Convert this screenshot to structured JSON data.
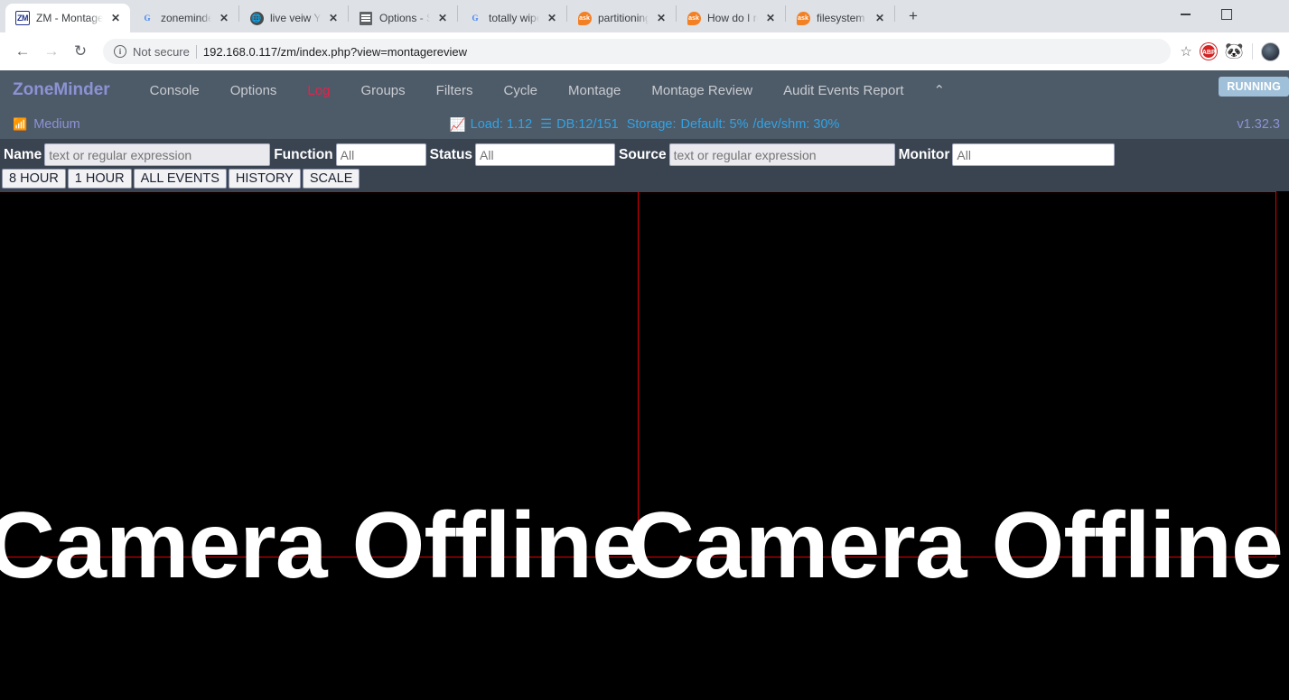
{
  "browser": {
    "tabs": [
      {
        "title": "ZM - Montage R",
        "favicon": "zm-icon",
        "active": true,
        "close_label": "✕"
      },
      {
        "title": "zoneminder opti",
        "favicon": "google-icon",
        "active": false,
        "close_label": "✕"
      },
      {
        "title": "live veiw YES on",
        "favicon": "globe-icon",
        "active": false,
        "close_label": "✕"
      },
      {
        "title": "Options - Server",
        "favicon": "options-icon",
        "active": false,
        "close_label": "✕"
      },
      {
        "title": "totally wipe ubun",
        "favicon": "google-icon",
        "active": false,
        "close_label": "✕"
      },
      {
        "title": "partitioning - Ho",
        "favicon": "askubuntu-icon",
        "active": false,
        "close_label": "✕"
      },
      {
        "title": "How do I reset U",
        "favicon": "askubuntu-icon",
        "active": false,
        "close_label": "✕"
      },
      {
        "title": "filesystem - How",
        "favicon": "askubuntu-icon",
        "active": false,
        "close_label": "✕"
      }
    ],
    "new_tab_label": "+",
    "window_controls": {
      "minimize": "—",
      "maximize": "□",
      "close": "✕"
    },
    "nav": {
      "back": "←",
      "forward": "→",
      "reload": "↻"
    },
    "omnibox": {
      "security_label": "Not secure",
      "info_icon": "info-icon",
      "url": "192.168.0.117/zm/index.php?view=montagereview",
      "star": "☆"
    },
    "extensions": [
      {
        "name": "adblock-plus-icon",
        "label": "ABP"
      },
      {
        "name": "evernote-icon",
        "label": "❯"
      }
    ],
    "profile": "avatar"
  },
  "zoneminder": {
    "brand": "ZoneMinder",
    "nav_items": [
      {
        "label": "Console",
        "active": false
      },
      {
        "label": "Options",
        "active": false
      },
      {
        "label": "Log",
        "active": true
      },
      {
        "label": "Groups",
        "active": false
      },
      {
        "label": "Filters",
        "active": false
      },
      {
        "label": "Cycle",
        "active": false
      },
      {
        "label": "Montage",
        "active": false
      },
      {
        "label": "Montage Review",
        "active": false
      },
      {
        "label": "Audit Events Report",
        "active": false
      }
    ],
    "collapse_caret": "⌃",
    "running_badge": "RUNNING",
    "status": {
      "bandwidth": "Medium",
      "bandwidth_icon": "wifi-icon",
      "load_icon": "trending-up-icon",
      "load": "Load: 1.12",
      "db_icon": "database-icon",
      "db": "DB:12/151",
      "storage_label": "Storage:",
      "storage_default": "Default: 5%",
      "storage_shm": "/dev/shm: 30%",
      "version": "v1.32.3"
    },
    "filters": [
      {
        "label": "Name",
        "placeholder": "text or regular expression",
        "value": "",
        "field": "name-input",
        "style": "grey"
      },
      {
        "label": "Function",
        "placeholder": "All",
        "value": "",
        "field": "function-input",
        "style": "white"
      },
      {
        "label": "Status",
        "placeholder": "All",
        "value": "",
        "field": "status-input",
        "style": "white"
      },
      {
        "label": "Source",
        "placeholder": "text or regular expression",
        "value": "",
        "field": "source-input",
        "style": "grey"
      },
      {
        "label": "Monitor",
        "placeholder": "All",
        "value": "",
        "field": "monitor-input",
        "style": "white"
      }
    ],
    "buttons": [
      "8 HOUR",
      "1 HOUR",
      "ALL EVENTS",
      "HISTORY",
      "SCALE"
    ],
    "monitors": [
      {
        "message": "Camera Offline"
      },
      {
        "message": "Camera Offline"
      }
    ],
    "colors": {
      "nav_background": "#4d5a68",
      "filter_background": "#3a4451",
      "brand": "#8c93d4",
      "log_active": "#e8214a",
      "status_link": "#2fa4e7",
      "monitor_border": "#e00000",
      "running_badge_bg": "#9fc0d8"
    }
  }
}
